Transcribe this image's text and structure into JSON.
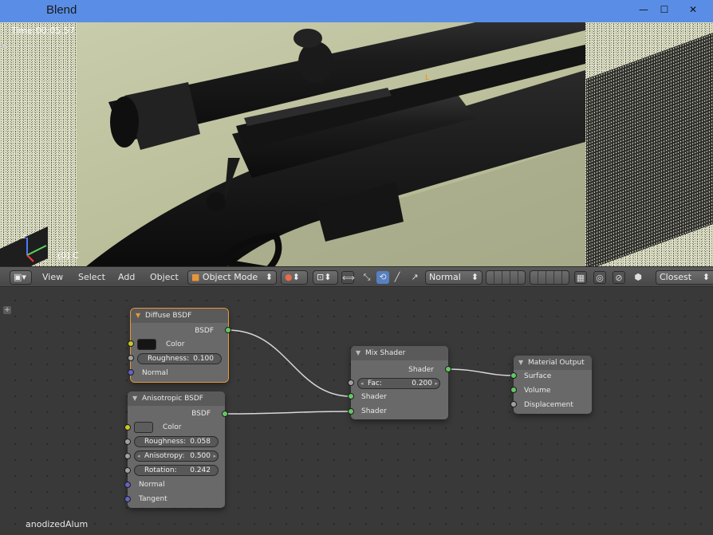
{
  "window": {
    "title": "Blend",
    "controls": {
      "minimize": "—",
      "maximize": "☐",
      "close": "✕"
    }
  },
  "viewport": {
    "time_label": "Time:00:05.57",
    "frame_label": "(0) C"
  },
  "header": {
    "menus": [
      "View",
      "Select",
      "Add",
      "Object"
    ],
    "mode": "Object Mode",
    "pivot": "Normal",
    "snap": "Closest"
  },
  "nodes": {
    "diffuse": {
      "title": "Diffuse BSDF",
      "output": "BSDF",
      "color_label": "Color",
      "color_value": "#151515",
      "roughness": {
        "label": "Roughness:",
        "value": "0.100"
      },
      "normal_label": "Normal"
    },
    "anisotropic": {
      "title": "Anisotropic BSDF",
      "output": "BSDF",
      "color_label": "Color",
      "color_value": "#5d5d5d",
      "roughness": {
        "label": "Roughness:",
        "value": "0.058"
      },
      "anisotropy": {
        "label": "Anisotropy:",
        "value": "0.500"
      },
      "rotation": {
        "label": "Rotation:",
        "value": "0.242"
      },
      "normal_label": "Normal",
      "tangent_label": "Tangent"
    },
    "mix": {
      "title": "Mix Shader",
      "output": "Shader",
      "fac": {
        "label": "Fac:",
        "value": "0.200"
      },
      "input1": "Shader",
      "input2": "Shader"
    },
    "output": {
      "title": "Material Output",
      "surface": "Surface",
      "volume": "Volume",
      "displacement": "Displacement"
    }
  },
  "material_name": "anodizedAlum",
  "colors": {
    "title_bar": "#5a8ee6",
    "node_selected_outline": "#e8953a",
    "shader_socket": "#63c763",
    "color_socket": "#c7c729",
    "value_socket": "#a1a1a1",
    "vector_socket": "#6363c7"
  }
}
